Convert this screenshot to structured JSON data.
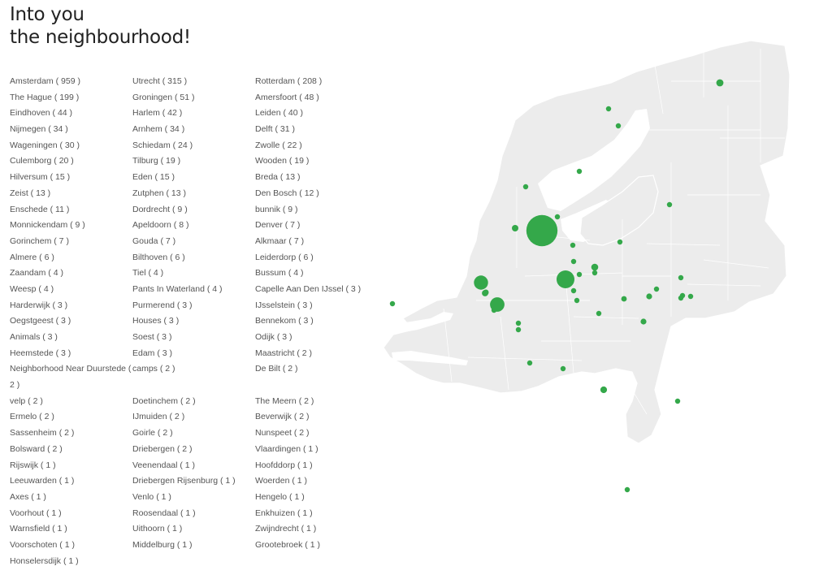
{
  "page": {
    "title_line1": "Into you",
    "title_line2": "the neighbourhood!"
  },
  "colors": {
    "dot": "#34a84a",
    "land": "#ececec",
    "border": "#ffffff"
  },
  "cities": [
    [
      "Amsterdam ( 959 )",
      "Utrecht ( 315 )",
      "Rotterdam ( 208 )"
    ],
    [
      "The Hague ( 199 )",
      "Groningen ( 51 )",
      "Amersfoort ( 48 )"
    ],
    [
      "Eindhoven ( 44 )",
      "Harlem ( 42 )",
      "Leiden ( 40 )"
    ],
    [
      "Nijmegen ( 34 )",
      "Arnhem ( 34 )",
      "Delft ( 31 )"
    ],
    [
      "Wageningen ( 30 )",
      "Schiedam ( 24 )",
      "Zwolle ( 22 )"
    ],
    [
      "Culemborg ( 20 )",
      "Tilburg ( 19 )",
      "Wooden ( 19 )"
    ],
    [
      "Hilversum ( 15 )",
      "Eden ( 15 )",
      "Breda ( 13 )"
    ],
    [
      "Zeist ( 13 )",
      "Zutphen ( 13 )",
      "Den Bosch ( 12 )"
    ],
    [
      "Enschede ( 11 )",
      "Dordrecht ( 9 )",
      "bunnik ( 9 )"
    ],
    [
      "Monnickendam ( 9 )",
      "Apeldoorn ( 8 )",
      "Denver ( 7 )"
    ],
    [
      "Gorinchem ( 7 )",
      "Gouda ( 7 )",
      "Alkmaar ( 7 )"
    ],
    [
      "Almere ( 6 )",
      "Bilthoven ( 6 )",
      "Leiderdorp ( 6 )"
    ],
    [
      "Zaandam ( 4 )",
      "Tiel ( 4 )",
      "Bussum ( 4 )"
    ],
    [
      "Weesp ( 4 )",
      "Pants In Waterland ( 4 )",
      "Capelle Aan Den IJssel ( 3 )"
    ],
    [
      "Harderwijk ( 3 )",
      "Purmerend ( 3 )",
      "IJsselstein ( 3 )"
    ],
    [
      "Oegstgeest ( 3 )",
      "Houses ( 3 )",
      "Bennekom ( 3 )"
    ],
    [
      "Animals ( 3 )",
      "Soest ( 3 )",
      "Odijk ( 3 )"
    ],
    [
      "Heemstede ( 3 )",
      "Edam ( 3 )",
      "Maastricht ( 2 )"
    ],
    [
      "Neighborhood Near Duurstede ( 2 )",
      "camps ( 2 )",
      "De Bilt ( 2 )"
    ],
    [
      "velp ( 2 )",
      "Doetinchem ( 2 )",
      "The Meern ( 2 )"
    ],
    [
      "Ermelo ( 2 )",
      "IJmuiden ( 2 )",
      "Beverwijk ( 2 )"
    ],
    [
      "Sassenheim ( 2 )",
      "Goirle ( 2 )",
      "Nunspeet ( 2 )"
    ],
    [
      "Bolsward ( 2 )",
      "Driebergen ( 2 )",
      "Vlaardingen ( 1 )"
    ],
    [
      "Rijswijk ( 1 )",
      "Veenendaal ( 1 )",
      "Hoofddorp ( 1 )"
    ],
    [
      "Leeuwarden ( 1 )",
      "Driebergen Rijsenburg ( 1 )",
      "Woerden ( 1 )"
    ],
    [
      "Axes ( 1 )",
      "Venlo ( 1 )",
      "Hengelo ( 1 )"
    ],
    [
      "Voorhout ( 1 )",
      "Roosendaal ( 1 )",
      "Enkhuizen ( 1 )"
    ],
    [
      "Warnsfield ( 1 )",
      "Uithoorn ( 1 )",
      "Zwijndrecht ( 1 )"
    ],
    [
      "Voorschoten ( 1 )",
      "Middelburg ( 1 )",
      "Grootebroek ( 1 )"
    ],
    [
      "Honselersdijk ( 1 )",
      "",
      ""
    ]
  ],
  "markers": [
    {
      "name": "Amsterdam",
      "count": 959
    },
    {
      "name": "Utrecht",
      "count": 315
    },
    {
      "name": "Rotterdam",
      "count": 208
    },
    {
      "name": "The Hague",
      "count": 199
    },
    {
      "name": "Groningen",
      "count": 51
    },
    {
      "name": "Amersfoort",
      "count": 48
    },
    {
      "name": "Eindhoven",
      "count": 44
    },
    {
      "name": "Harlem",
      "count": 42
    },
    {
      "name": "Leiden",
      "count": 40
    },
    {
      "name": "Nijmegen",
      "count": 34
    },
    {
      "name": "Arnhem",
      "count": 34
    },
    {
      "name": "Delft",
      "count": 31
    },
    {
      "name": "Wageningen",
      "count": 30
    },
    {
      "name": "Schiedam",
      "count": 24
    },
    {
      "name": "Zwolle",
      "count": 22
    },
    {
      "name": "Culemborg",
      "count": 20
    },
    {
      "name": "Tilburg",
      "count": 19
    },
    {
      "name": "Hilversum",
      "count": 15
    },
    {
      "name": "Eden",
      "count": 15
    },
    {
      "name": "Breda",
      "count": 13
    },
    {
      "name": "Zeist",
      "count": 13
    },
    {
      "name": "Zutphen",
      "count": 13
    },
    {
      "name": "Den Bosch",
      "count": 12
    },
    {
      "name": "Enschede",
      "count": 11
    },
    {
      "name": "Dordrecht",
      "count": 9
    },
    {
      "name": "Monnickendam",
      "count": 9
    },
    {
      "name": "Apeldoorn",
      "count": 8
    },
    {
      "name": "Alkmaar",
      "count": 7
    },
    {
      "name": "Almere",
      "count": 6
    },
    {
      "name": "Zaandam",
      "count": 4
    },
    {
      "name": "Harderwijk",
      "count": 3
    },
    {
      "name": "Leeuwarden",
      "count": 1
    },
    {
      "name": "Bolsward",
      "count": 2
    },
    {
      "name": "Maastricht",
      "count": 2
    },
    {
      "name": "Venlo",
      "count": 1
    },
    {
      "name": "Middelburg",
      "count": 1
    },
    {
      "name": "Roosendaal",
      "count": 1
    },
    {
      "name": "Hengelo",
      "count": 1
    },
    {
      "name": "Enkhuizen",
      "count": 1
    },
    {
      "name": "Doetinchem",
      "count": 2
    },
    {
      "name": "Tiel",
      "count": 4
    }
  ]
}
